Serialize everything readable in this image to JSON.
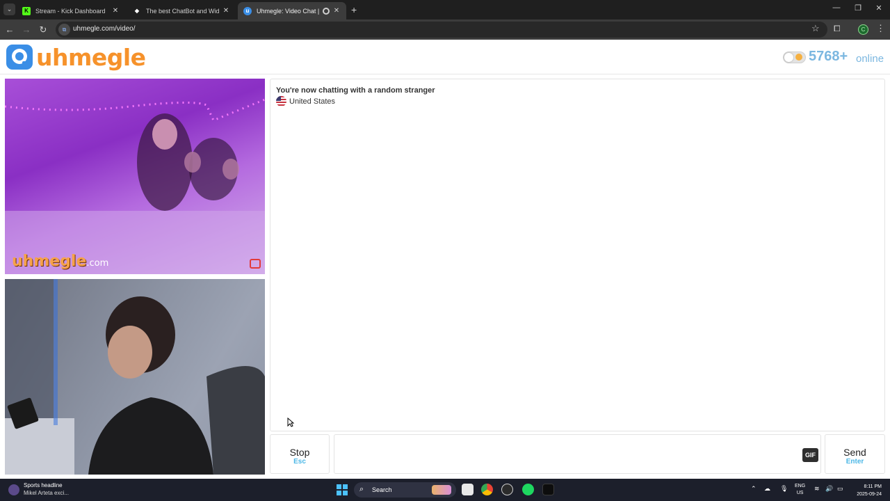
{
  "browser": {
    "tabs": [
      {
        "title": "Stream - Kick Dashboard",
        "favicon": "kick-icon"
      },
      {
        "title": "The best ChatBot and Widgets",
        "favicon": "botrix-icon"
      },
      {
        "title": "Uhmegle: Video Chat | Ome",
        "favicon": "uhmegle-icon"
      }
    ],
    "url": "uhmegle.com/video/",
    "profile_initial": "C"
  },
  "site": {
    "logo_text": "uhmegle",
    "online_count": "5768+",
    "online_label": "online"
  },
  "video": {
    "watermark_main": "uhmegle",
    "watermark_suffix": ".com"
  },
  "chat": {
    "status": "You're now chatting with a random stranger",
    "country": "United States"
  },
  "controls": {
    "stop_label": "Stop",
    "stop_hint": "Esc",
    "send_label": "Send",
    "send_hint": "Enter",
    "gif_label": "GIF",
    "message_placeholder": ""
  },
  "taskbar": {
    "news_title": "Sports headline",
    "news_sub": "Mikel Arteta exci...",
    "search_label": "Search",
    "lang_line1": "ENG",
    "lang_line2": "US",
    "time": "8:11 PM",
    "date": "2025-09-24"
  },
  "colors": {
    "brand_orange": "#f6922b",
    "brand_blue": "#4cb7e6",
    "online_blue": "#7bb7e0"
  }
}
